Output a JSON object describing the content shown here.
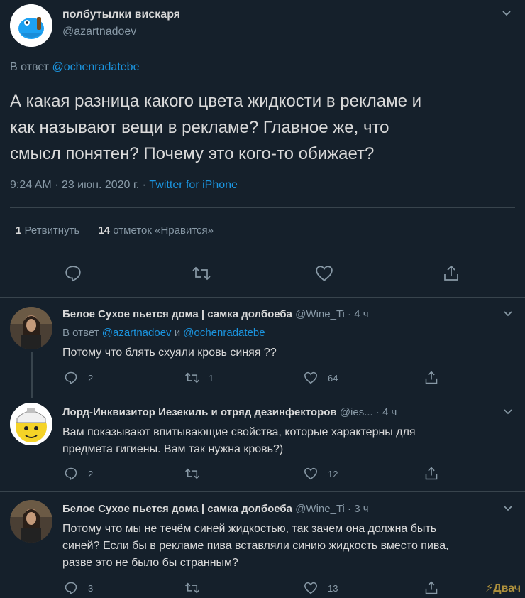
{
  "main_tweet": {
    "author_name": "полбутылки вискаря",
    "author_handle": "@azartnadoev",
    "reply_prefix": "В ответ",
    "reply_to": "@ochenradatebe",
    "text_lines": [
      "А какая разница какого цвета жидкости в рекламе и",
      "как называют вещи в рекламе? Главное же, что",
      "смысл понятен? Почему это кого-то обижает?"
    ],
    "timestamp": "9:24 AM · 23 июн. 2020 г. ·",
    "source": "Twitter for iPhone",
    "retweets_count": "1",
    "retweets_label": "Ретвитнуть",
    "likes_count": "14",
    "likes_label": "отметок «Нравится»"
  },
  "replies": [
    {
      "author_name": "Белое Сухое пьется дома | самка долбоеба",
      "handle_time": "@Wine_Ti · 4 ч",
      "reply_prefix": "В ответ",
      "reply_to_1": "@azartnadoev",
      "reply_and": "и",
      "reply_to_2": "@ochenradatebe",
      "text_lines": [
        "Потому что блять схуяли кровь синяя ??"
      ],
      "reply_count": "2",
      "retweet_count": "1",
      "like_count": "64"
    },
    {
      "author_name": "Лорд-Инквизитор Иезекиль и отряд дезинфекторов",
      "handle_time": "@ies... · 4 ч",
      "text_lines": [
        "Вам показывают впитывающие свойства, которые характерны для",
        "предмета гигиены. Вам так нужна кровь?)"
      ],
      "reply_count": "2",
      "retweet_count": "",
      "like_count": "12"
    },
    {
      "author_name": "Белое Сухое пьется дома | самка долбоеба",
      "handle_time": "@Wine_Ti · 3 ч",
      "text_lines": [
        "Потому что мы не течём синей жидкостью, так зачем она должна быть",
        "синей? Если бы в рекламе пива вставляли синию жидкость вместо пива,",
        "разве это не было бы странным?"
      ],
      "reply_count": "3",
      "retweet_count": "",
      "like_count": "13"
    }
  ],
  "watermark": "⚡Двач",
  "colors": {
    "background": "#15202b",
    "link": "#1b95e0",
    "muted": "#8899a6",
    "text": "#d9d9d9",
    "divider": "#38444d"
  }
}
